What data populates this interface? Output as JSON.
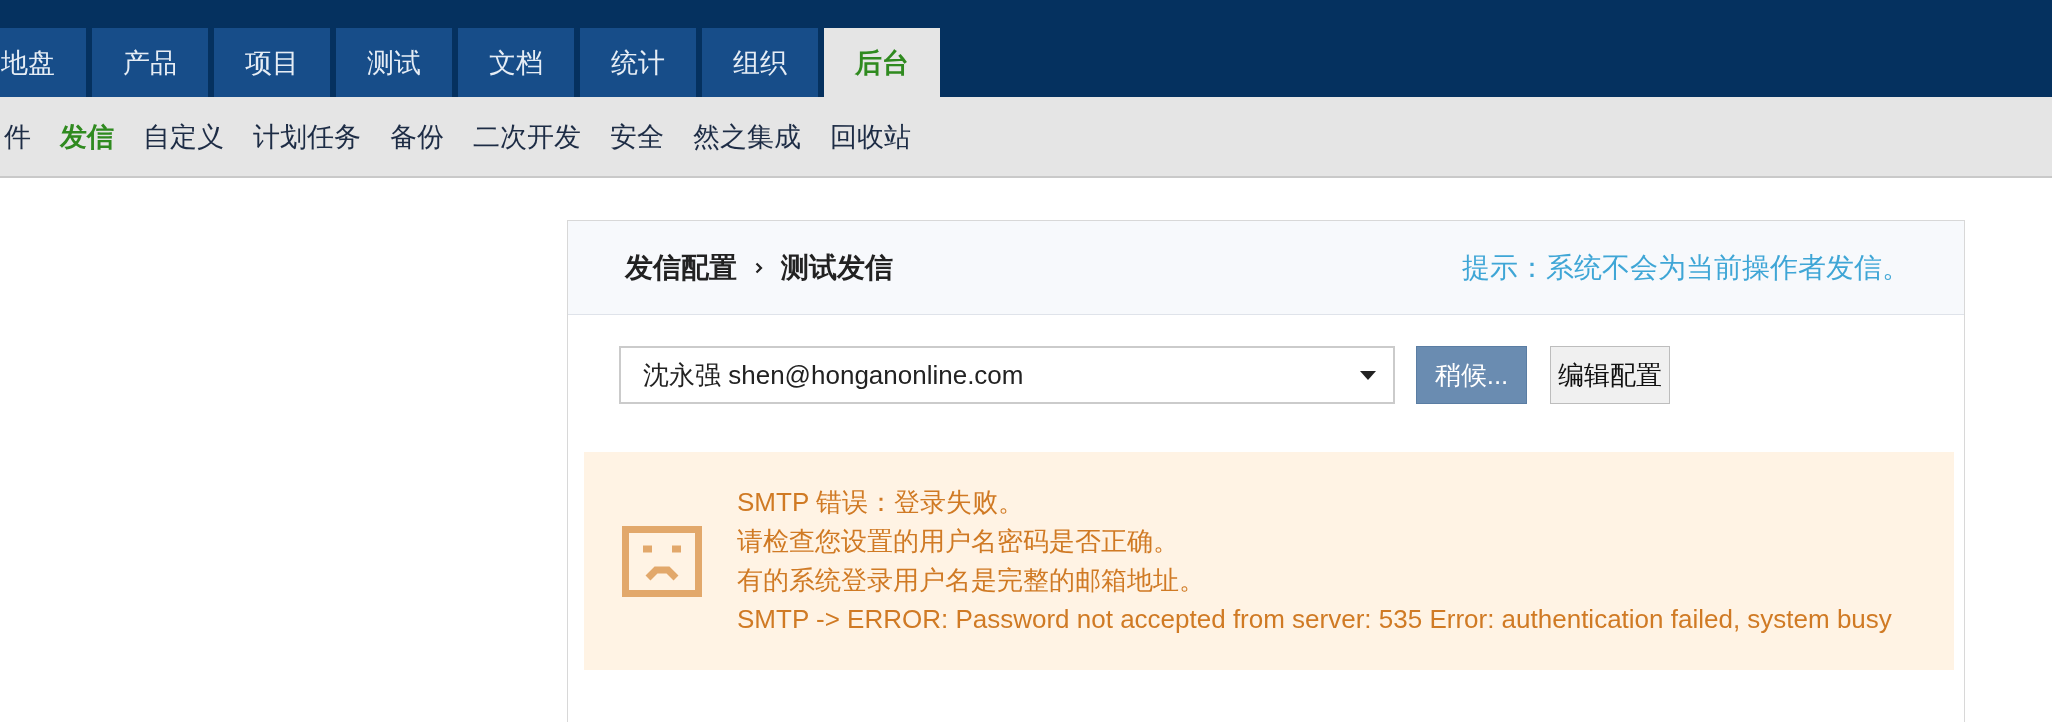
{
  "top_nav": {
    "tabs": [
      {
        "label": "地盘",
        "selected": false
      },
      {
        "label": "产品",
        "selected": false
      },
      {
        "label": "项目",
        "selected": false
      },
      {
        "label": "测试",
        "selected": false
      },
      {
        "label": "文档",
        "selected": false
      },
      {
        "label": "统计",
        "selected": false
      },
      {
        "label": "组织",
        "selected": false
      },
      {
        "label": "后台",
        "selected": true
      }
    ]
  },
  "sub_nav": {
    "items": [
      {
        "label": "件",
        "selected": false
      },
      {
        "label": "发信",
        "selected": true
      },
      {
        "label": "自定义",
        "selected": false
      },
      {
        "label": "计划任务",
        "selected": false
      },
      {
        "label": "备份",
        "selected": false
      },
      {
        "label": "二次开发",
        "selected": false
      },
      {
        "label": "安全",
        "selected": false
      },
      {
        "label": "然之集成",
        "selected": false
      },
      {
        "label": "回收站",
        "selected": false
      }
    ]
  },
  "panel": {
    "breadcrumb": [
      "发信配置",
      "测试发信"
    ],
    "hint": "提示：系统不会为当前操作者发信。",
    "recipient_select": {
      "value": "沈永强 shen@honganonline.com"
    },
    "buttons": [
      {
        "label": "稍候...",
        "kind": "primary",
        "disabled": true
      },
      {
        "label": "编辑配置",
        "kind": "default",
        "disabled": false
      }
    ],
    "alert": {
      "kind": "error",
      "lines": [
        "SMTP 错误：登录失败。",
        "请检查您设置的用户名密码是否正确。",
        "有的系统登录用户名是完整的邮箱地址。",
        "SMTP -> ERROR: Password not accepted from server: 535 Error: authentication failed, system busy"
      ]
    }
  }
}
